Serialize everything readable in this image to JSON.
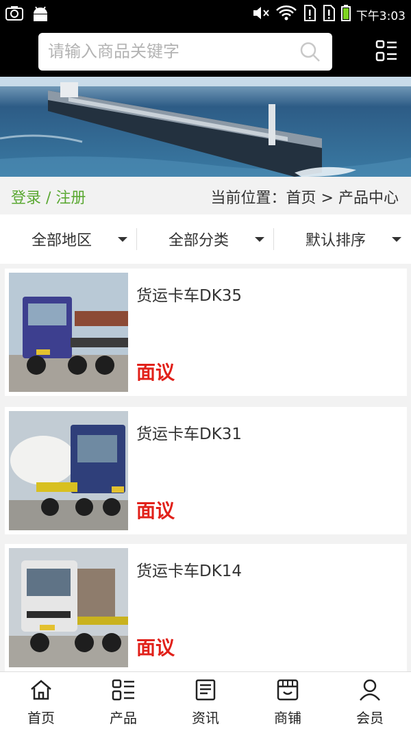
{
  "status_bar": {
    "time": "下午3:03"
  },
  "search": {
    "placeholder": "请输入商品关键字"
  },
  "account": {
    "login": "登录",
    "separator": " / ",
    "register": "注册"
  },
  "breadcrumb": {
    "prefix": "当前位置：",
    "home": "首页",
    "arrow": " > ",
    "current": "产品中心"
  },
  "filters": [
    {
      "label": "全部地区"
    },
    {
      "label": "全部分类"
    },
    {
      "label": "默认排序"
    }
  ],
  "products": [
    {
      "name": "货运卡车DK35",
      "price": "面议",
      "cab_color": "#3d3f8f"
    },
    {
      "name": "货运卡车DK31",
      "price": "面议",
      "cab_color": "#2f3f7a"
    },
    {
      "name": "货运卡车DK14",
      "price": "面议",
      "cab_color": "#e6e6e6"
    }
  ],
  "tabs": [
    {
      "label": "首页",
      "icon": "home-icon"
    },
    {
      "label": "产品",
      "icon": "grid-list-icon"
    },
    {
      "label": "资讯",
      "icon": "document-icon"
    },
    {
      "label": "商铺",
      "icon": "shop-icon"
    },
    {
      "label": "会员",
      "icon": "user-icon"
    }
  ],
  "colors": {
    "accent_green": "#5aa832",
    "price_red": "#e1211a",
    "header_black": "#000000"
  }
}
